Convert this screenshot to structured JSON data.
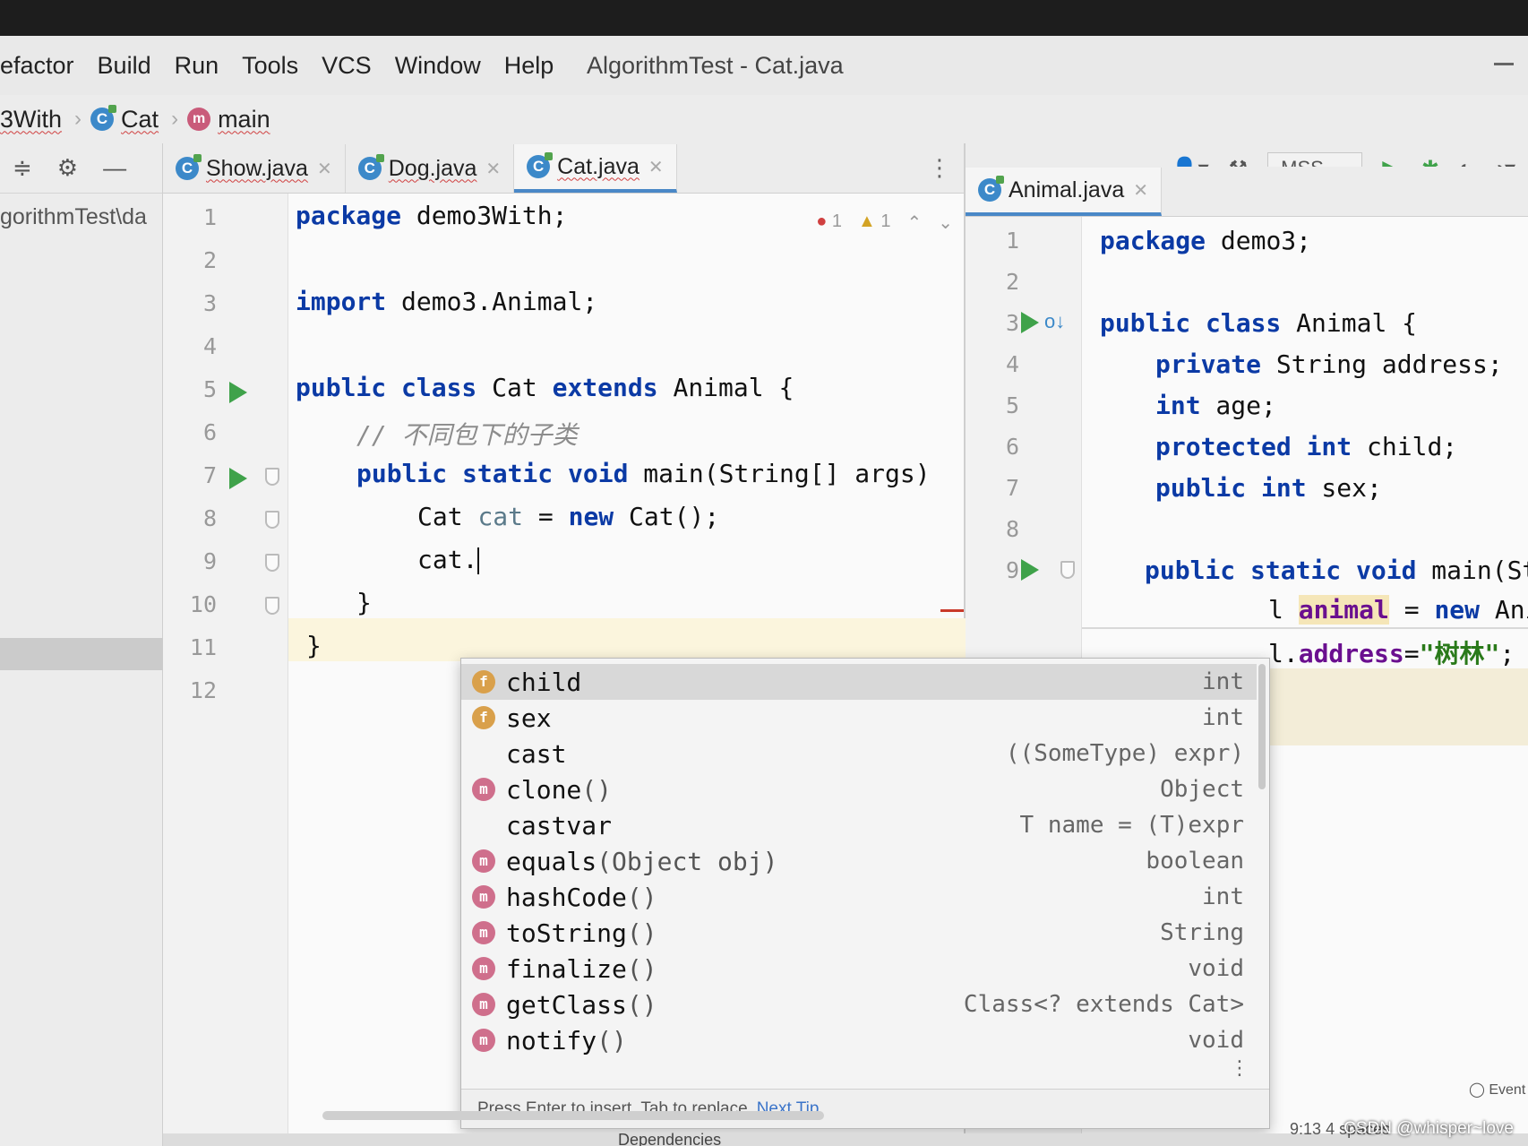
{
  "menu": {
    "items": [
      "efactor",
      "Build",
      "Run",
      "Tools",
      "VCS",
      "Window",
      "Help"
    ],
    "window_title": "AlgorithmTest - Cat.java"
  },
  "breadcrumb": {
    "items": [
      {
        "label": "3With",
        "icon": "package-icon"
      },
      {
        "label": "Cat",
        "icon": "class-icon"
      },
      {
        "label": "main",
        "icon": "method-icon"
      }
    ]
  },
  "project": {
    "path": "gorithmTest\\da"
  },
  "left_editor": {
    "tabs": [
      {
        "label": "Show.java",
        "active": false
      },
      {
        "label": "Dog.java",
        "active": false
      },
      {
        "label": "Cat.java",
        "active": true
      }
    ],
    "inspections": {
      "errors": "1",
      "warnings": "1"
    },
    "line_numbers": [
      "1",
      "2",
      "3",
      "4",
      "5",
      "6",
      "7",
      "8",
      "9",
      "10",
      "11",
      "12"
    ],
    "lines": {
      "l1_kw": "package",
      "l1_rest": " demo3With;",
      "l3_kw": "import",
      "l3_rest": " demo3.Animal;",
      "l5_kw1": "public class",
      "l5_mid": " Cat ",
      "l5_kw2": "extends",
      "l5_rest": " Animal {",
      "l6_comment": "// 不同包下的子类",
      "l7_kw": "public static void",
      "l7_rest": " main(String[] args)",
      "l8_a": "Cat ",
      "l8_var": "cat",
      "l8_b": " = ",
      "l8_kw": "new",
      "l8_c": " Cat();",
      "l9_text": "cat.",
      "l10_text": "}",
      "l11_text": "}"
    }
  },
  "right_toolbar": {
    "run_config": "MSS"
  },
  "right_editor": {
    "tabs": [
      {
        "label": "Animal.java",
        "active": true
      }
    ],
    "line_numbers": [
      "1",
      "2",
      "3",
      "4",
      "5",
      "6",
      "7",
      "8",
      "9"
    ],
    "lines": {
      "l1_kw": "package",
      "l1_rest": " demo3;",
      "l3_kw": "public class",
      "l3_rest": " Animal {",
      "l4_kw": "private",
      "l4_rest": " String address;",
      "l5_kw": "int",
      "l5_rest": " age;",
      "l6_kw": "protected int",
      "l6_rest": " child;",
      "l7_kw": "public int",
      "l7_rest": " sex;",
      "l9_kw": "public static void",
      "l9_rest": " main(Strin",
      "l10_a": "l ",
      "l10_var": "animal",
      "l10_b": " = ",
      "l10_kw": "new",
      "l10_c": " Anima",
      "l11_a": "l.",
      "l11_fld": "address",
      "l11_b": "=",
      "l11_str": "\"树林\"",
      "l11_c": ";"
    }
  },
  "completion": {
    "items": [
      {
        "icon": "f",
        "name": "child",
        "params": "",
        "type": "int"
      },
      {
        "icon": "f",
        "name": "sex",
        "params": "",
        "type": "int"
      },
      {
        "icon": "",
        "name": "cast",
        "params": "",
        "type": "((SomeType) expr)"
      },
      {
        "icon": "m",
        "name": "clone",
        "params": "()",
        "type": "Object"
      },
      {
        "icon": "",
        "name": "castvar",
        "params": "",
        "type": "T name = (T)expr"
      },
      {
        "icon": "m",
        "name": "equals",
        "params": "(Object obj)",
        "type": "boolean"
      },
      {
        "icon": "m",
        "name": "hashCode",
        "params": "()",
        "type": "int"
      },
      {
        "icon": "m",
        "name": "toString",
        "params": "()",
        "type": "String"
      },
      {
        "icon": "m",
        "name": "finalize",
        "params": "()",
        "type": "void"
      },
      {
        "icon": "m",
        "name": "getClass",
        "params": "()",
        "type": "Class<? extends Cat>"
      },
      {
        "icon": "m",
        "name": "notify",
        "params": "()",
        "type": "void"
      }
    ],
    "footer": "Press Enter to insert, Tab to replace",
    "next_tip": "Next Tip"
  },
  "status": {
    "dependencies": "Dependencies",
    "position": "9:13",
    "indent": "4 spaces",
    "event_log": "Event"
  },
  "watermark": "CSDN @whisper~love"
}
